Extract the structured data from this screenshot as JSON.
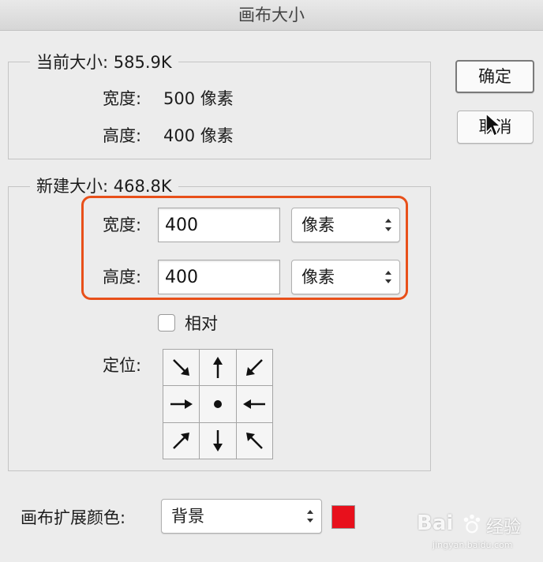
{
  "window": {
    "title": "画布大小"
  },
  "current_size": {
    "title": "当前大小: 585.9K",
    "width_label": "宽度:",
    "width_value": "500 像素",
    "height_label": "高度:",
    "height_value": "400 像素"
  },
  "new_size": {
    "title": "新建大小: 468.8K",
    "width_label": "宽度:",
    "width_value": "400",
    "width_unit": "像素",
    "height_label": "高度:",
    "height_value": "400",
    "height_unit": "像素",
    "relative_label": "相对",
    "relative_checked": false,
    "anchor_label": "定位:",
    "anchor_selected": "center"
  },
  "buttons": {
    "ok": "确定",
    "cancel": "取消"
  },
  "extension": {
    "label": "画布扩展颜色:",
    "value": "背景",
    "swatch_color": "#e8101c"
  },
  "colors": {
    "highlight": "#e8501a"
  },
  "watermark": {
    "brand": "Bai",
    "brand2": "经验",
    "url": "jingyan.baidu.com"
  }
}
